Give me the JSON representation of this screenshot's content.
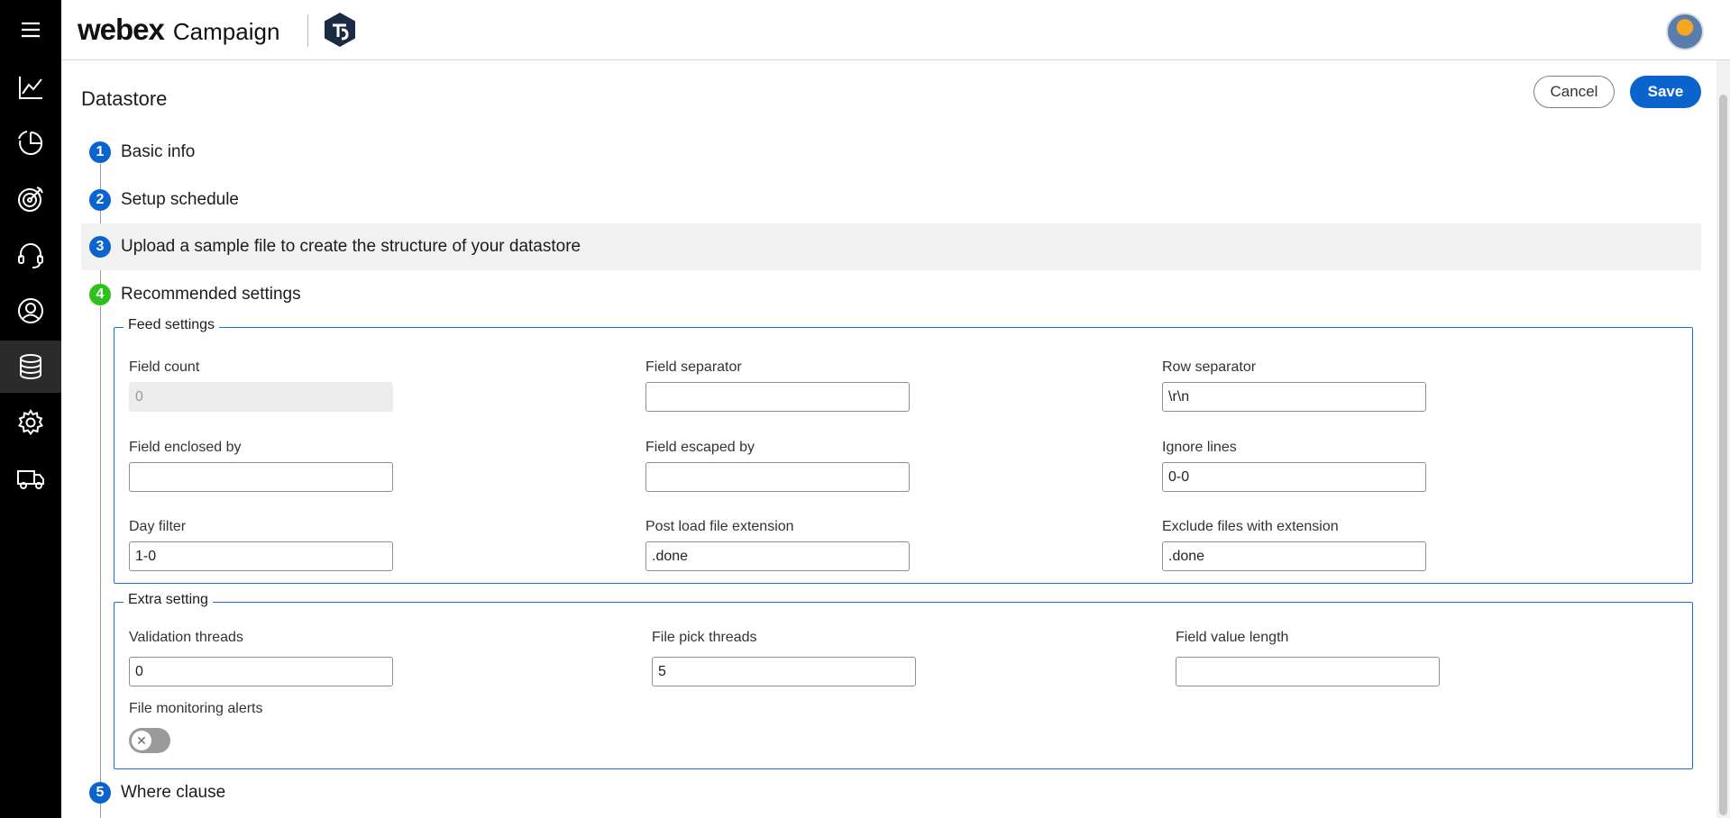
{
  "app": {
    "brand_name": "webex",
    "product_name": "Campaign"
  },
  "sidebar": {
    "items": [
      {
        "icon": "menu-icon"
      },
      {
        "icon": "analytics-chart-icon"
      },
      {
        "icon": "pie-chart-icon"
      },
      {
        "icon": "target-icon"
      },
      {
        "icon": "headset-icon"
      },
      {
        "icon": "user-profile-icon"
      },
      {
        "icon": "database-icon",
        "active": true
      },
      {
        "icon": "gear-icon"
      },
      {
        "icon": "truck-icon"
      }
    ]
  },
  "page": {
    "title": "Datastore",
    "cancel_label": "Cancel",
    "save_label": "Save"
  },
  "steps": [
    {
      "number": "1",
      "label": "Basic info"
    },
    {
      "number": "2",
      "label": "Setup schedule"
    },
    {
      "number": "3",
      "label": "Upload a sample file to create the structure of your datastore"
    },
    {
      "number": "4",
      "label": "Recommended settings"
    },
    {
      "number": "5",
      "label": "Where clause"
    }
  ],
  "feed_settings": {
    "legend": "Feed settings",
    "field_count": {
      "label": "Field count",
      "value": "0"
    },
    "field_separator": {
      "label": "Field separator",
      "value": ""
    },
    "row_separator": {
      "label": "Row separator",
      "value": "\\r\\n"
    },
    "field_enclosed_by": {
      "label": "Field enclosed by",
      "value": ""
    },
    "field_escaped_by": {
      "label": "Field escaped by",
      "value": ""
    },
    "ignore_lines": {
      "label": "Ignore lines",
      "value": "0-0"
    },
    "day_filter": {
      "label": "Day filter",
      "value": "1-0"
    },
    "post_load_ext": {
      "label": "Post load file extension",
      "value": ".done"
    },
    "exclude_ext": {
      "label": "Exclude files with extension",
      "value": ".done"
    }
  },
  "extra_setting": {
    "legend": "Extra setting",
    "validation_threads": {
      "label": "Validation threads",
      "value": "0"
    },
    "file_pick_threads": {
      "label": "File pick threads",
      "value": "5"
    },
    "field_value_length": {
      "label": "Field value length",
      "value": ""
    },
    "file_monitoring_alerts": {
      "label": "File monitoring alerts",
      "enabled": false,
      "knob_glyph": "✕"
    }
  },
  "colors": {
    "primary": "#0b63ce",
    "step_active": "#2ec11c",
    "sidebar_bg": "#000000",
    "fieldset_border": "#1b6fd6"
  }
}
